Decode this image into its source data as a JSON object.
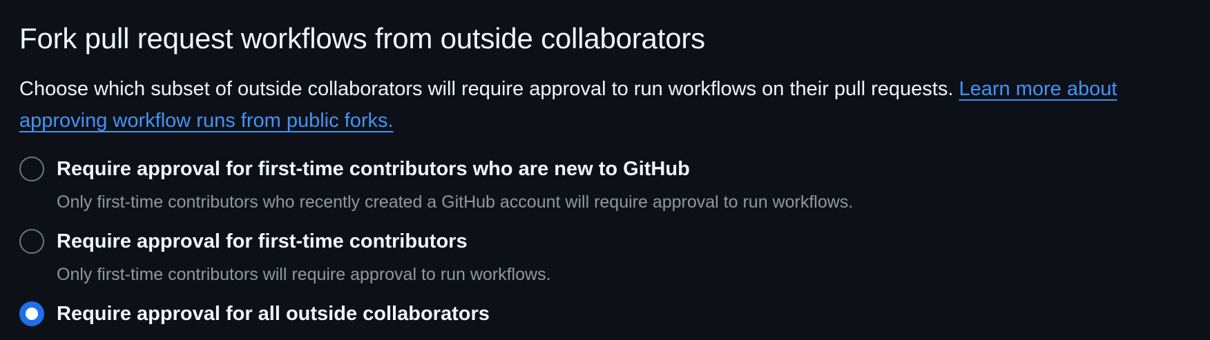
{
  "section": {
    "title": "Fork pull request workflows from outside collaborators",
    "description": "Choose which subset of outside collaborators will require approval to run workflows on their pull requests.",
    "learn_more_link": "Learn more about approving workflow runs from public forks."
  },
  "options": [
    {
      "label": "Require approval for first-time contributors who are new to GitHub",
      "note": "Only first-time contributors who recently created a GitHub account will require approval to run workflows.",
      "selected": false
    },
    {
      "label": "Require approval for first-time contributors",
      "note": "Only first-time contributors will require approval to run workflows.",
      "selected": false
    },
    {
      "label": "Require approval for all outside collaborators",
      "selected": true
    }
  ],
  "colors": {
    "background": "#0d1117",
    "text": "#f0f6fc",
    "muted": "#9198a1",
    "link": "#4493f8",
    "accent": "#1f6feb"
  }
}
